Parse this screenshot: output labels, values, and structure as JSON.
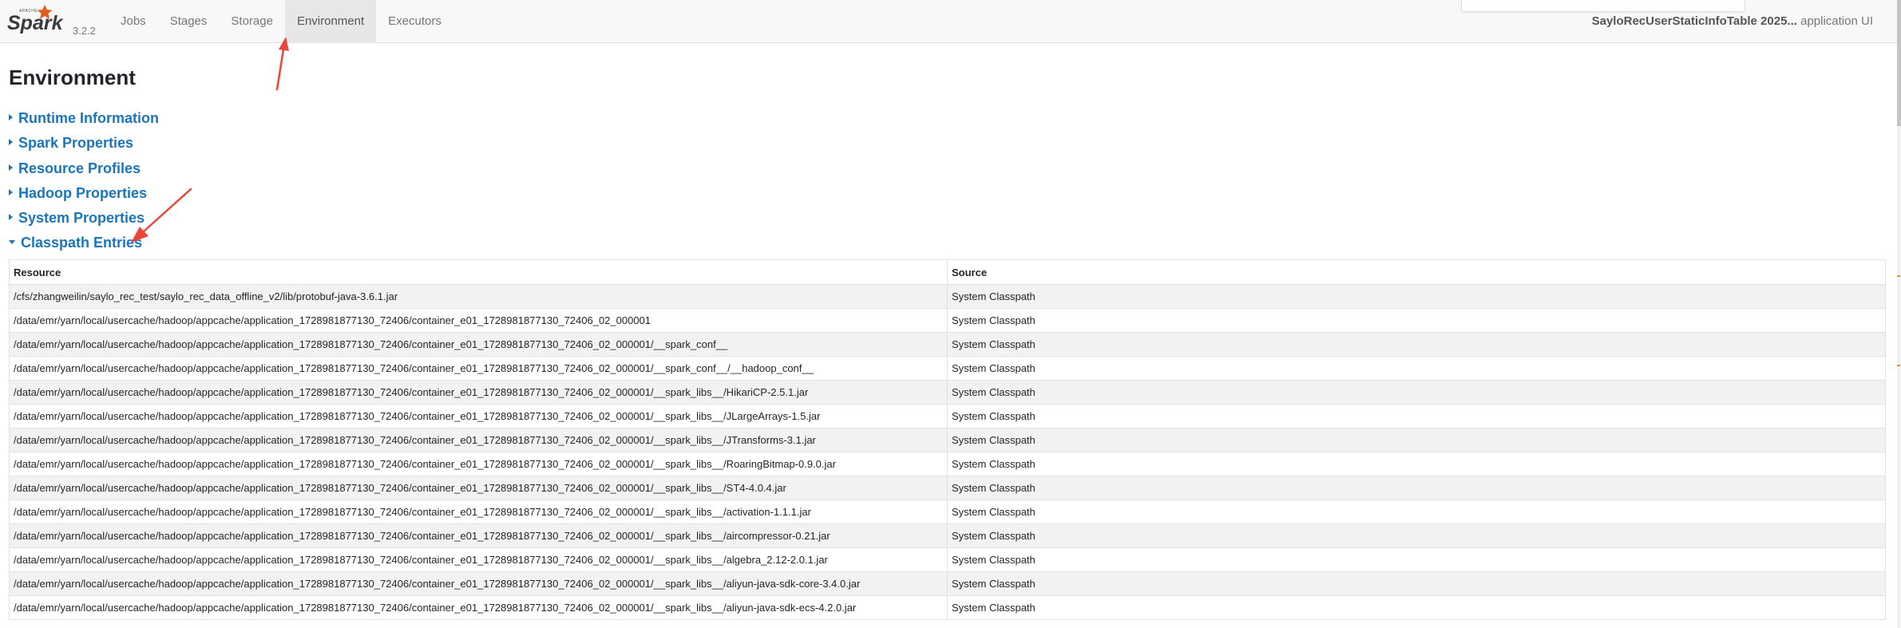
{
  "navbar": {
    "logo_top_text": "APACHE",
    "logo_text": "Spark",
    "version": "3.2.2",
    "links": [
      {
        "label": "Jobs",
        "active": false
      },
      {
        "label": "Stages",
        "active": false
      },
      {
        "label": "Storage",
        "active": false
      },
      {
        "label": "Environment",
        "active": true
      },
      {
        "label": "Executors",
        "active": false
      }
    ],
    "app_name": "SayloRecUserStaticInfoTable 2025...",
    "app_suffix": "application UI"
  },
  "page": {
    "title": "Environment",
    "sections": [
      {
        "label": "Runtime Information",
        "expanded": false
      },
      {
        "label": "Spark Properties",
        "expanded": false
      },
      {
        "label": "Resource Profiles",
        "expanded": false
      },
      {
        "label": "Hadoop Properties",
        "expanded": false
      },
      {
        "label": "System Properties",
        "expanded": false
      },
      {
        "label": "Classpath Entries",
        "expanded": true
      }
    ]
  },
  "classpath_table": {
    "headers": [
      "Resource",
      "Source"
    ],
    "rows": [
      [
        "/cfs/zhangweilin/saylo_rec_test/saylo_rec_data_offline_v2/lib/protobuf-java-3.6.1.jar",
        "System Classpath"
      ],
      [
        "/data/emr/yarn/local/usercache/hadoop/appcache/application_1728981877130_72406/container_e01_1728981877130_72406_02_000001",
        "System Classpath"
      ],
      [
        "/data/emr/yarn/local/usercache/hadoop/appcache/application_1728981877130_72406/container_e01_1728981877130_72406_02_000001/__spark_conf__",
        "System Classpath"
      ],
      [
        "/data/emr/yarn/local/usercache/hadoop/appcache/application_1728981877130_72406/container_e01_1728981877130_72406_02_000001/__spark_conf__/__hadoop_conf__",
        "System Classpath"
      ],
      [
        "/data/emr/yarn/local/usercache/hadoop/appcache/application_1728981877130_72406/container_e01_1728981877130_72406_02_000001/__spark_libs__/HikariCP-2.5.1.jar",
        "System Classpath"
      ],
      [
        "/data/emr/yarn/local/usercache/hadoop/appcache/application_1728981877130_72406/container_e01_1728981877130_72406_02_000001/__spark_libs__/JLargeArrays-1.5.jar",
        "System Classpath"
      ],
      [
        "/data/emr/yarn/local/usercache/hadoop/appcache/application_1728981877130_72406/container_e01_1728981877130_72406_02_000001/__spark_libs__/JTransforms-3.1.jar",
        "System Classpath"
      ],
      [
        "/data/emr/yarn/local/usercache/hadoop/appcache/application_1728981877130_72406/container_e01_1728981877130_72406_02_000001/__spark_libs__/RoaringBitmap-0.9.0.jar",
        "System Classpath"
      ],
      [
        "/data/emr/yarn/local/usercache/hadoop/appcache/application_1728981877130_72406/container_e01_1728981877130_72406_02_000001/__spark_libs__/ST4-4.0.4.jar",
        "System Classpath"
      ],
      [
        "/data/emr/yarn/local/usercache/hadoop/appcache/application_1728981877130_72406/container_e01_1728981877130_72406_02_000001/__spark_libs__/activation-1.1.1.jar",
        "System Classpath"
      ],
      [
        "/data/emr/yarn/local/usercache/hadoop/appcache/application_1728981877130_72406/container_e01_1728981877130_72406_02_000001/__spark_libs__/aircompressor-0.21.jar",
        "System Classpath"
      ],
      [
        "/data/emr/yarn/local/usercache/hadoop/appcache/application_1728981877130_72406/container_e01_1728981877130_72406_02_000001/__spark_libs__/algebra_2.12-2.0.1.jar",
        "System Classpath"
      ],
      [
        "/data/emr/yarn/local/usercache/hadoop/appcache/application_1728981877130_72406/container_e01_1728981877130_72406_02_000001/__spark_libs__/aliyun-java-sdk-core-3.4.0.jar",
        "System Classpath"
      ],
      [
        "/data/emr/yarn/local/usercache/hadoop/appcache/application_1728981877130_72406/container_e01_1728981877130_72406_02_000001/__spark_libs__/aliyun-java-sdk-ecs-4.2.0.jar",
        "System Classpath"
      ]
    ]
  },
  "colors": {
    "link": "#1b75bb",
    "annotation_arrow": "#e8483b",
    "logo_star": "#e25a1c"
  },
  "icons": {
    "collapsed_section": "triangle-right-icon",
    "expanded_section": "triangle-down-icon",
    "logo": "spark-star-icon",
    "annotation": "red-arrow-icon"
  }
}
